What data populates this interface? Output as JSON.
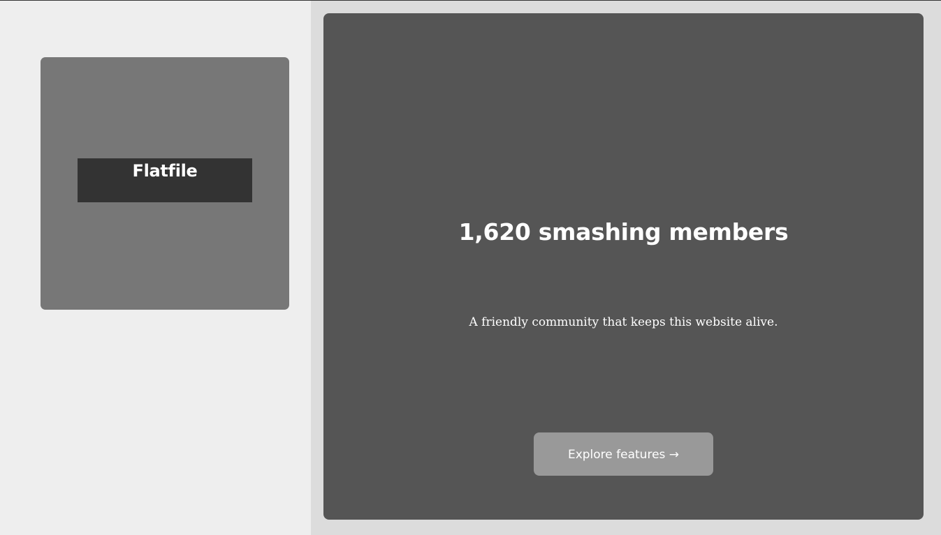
{
  "sidebar": {
    "logo_text": "Flatfile"
  },
  "hero": {
    "title": "1,620 smashing members",
    "subtitle": "A friendly community that keeps this website alive.",
    "cta_label": "Explore features →"
  },
  "colors": {
    "page_background": "#dcdcdc",
    "left_panel": "#eeeeee",
    "logo_card": "#777777",
    "logo_plate": "#333333",
    "hero_card": "#555555",
    "cta_button": "#999999",
    "text": "#ffffff"
  }
}
